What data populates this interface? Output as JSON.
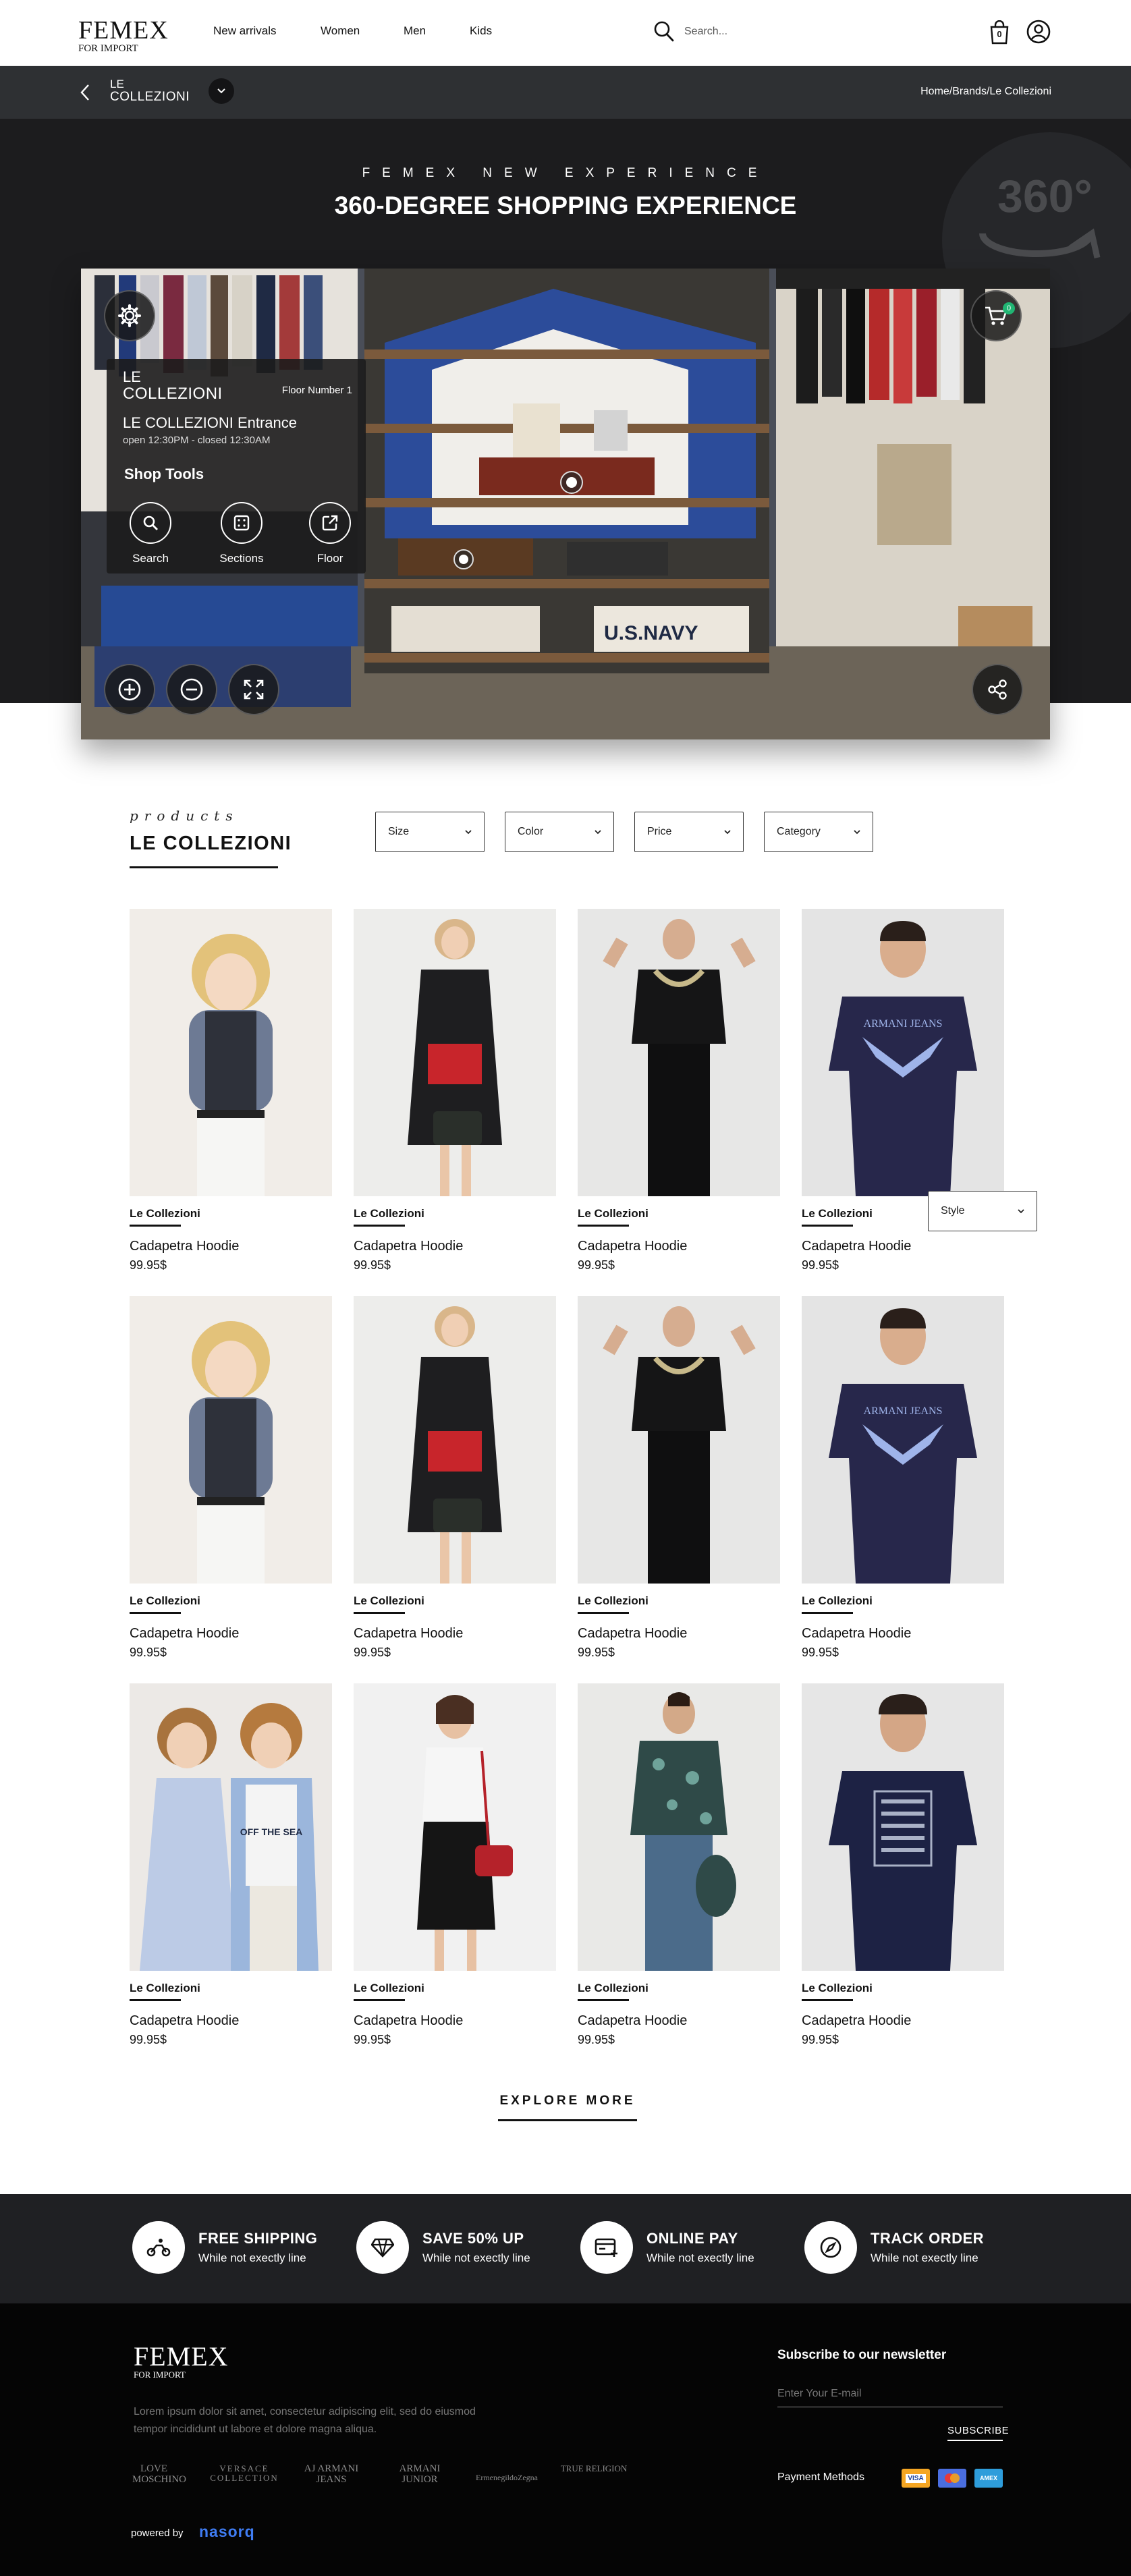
{
  "header": {
    "logo_main": "FEMEX",
    "logo_sub": "FOR IMPORT",
    "nav": [
      "New arrivals",
      "Women",
      "Men",
      "Kids"
    ],
    "search_placeholder": "Search...",
    "cart_count": "0"
  },
  "subbar": {
    "brand_top": "LE",
    "brand_bottom": "COLLEZIONI",
    "breadcrumb": "Home/Brands/Le Collezioni"
  },
  "hero": {
    "kicker": "FEMEX NEW EXPERIENCE",
    "title": "360-DEGREE SHOPPING EXPERIENCE",
    "badge": "360°",
    "panel": {
      "brand_top": "LE",
      "brand_bottom": "COLLEZIONI",
      "floor": "Floor Number 1",
      "entrance": "LE COLLEZIONI Entrance",
      "hours": "open 12:30PM - closed 12:30AM",
      "tools_title": "Shop Tools",
      "tools": [
        "Search",
        "Sections",
        "Floor"
      ]
    },
    "cart_badge": "0",
    "navy_text": "U.S.NAVY"
  },
  "products": {
    "kicker": "products",
    "title": "LE COLLEZIONI",
    "filters": [
      "Size",
      "Color",
      "Price",
      "Category"
    ],
    "style_filter": "Style",
    "items": [
      {
        "brand": "Le Collezioni",
        "name": "Cadapetra Hoodie",
        "price": "99.95$"
      },
      {
        "brand": "Le Collezioni",
        "name": "Cadapetra Hoodie",
        "price": "99.95$"
      },
      {
        "brand": "Le Collezioni",
        "name": "Cadapetra Hoodie",
        "price": "99.95$"
      },
      {
        "brand": "Le Collezioni",
        "name": "Cadapetra Hoodie",
        "price": "99.95$"
      },
      {
        "brand": "Le Collezioni",
        "name": "Cadapetra Hoodie",
        "price": "99.95$"
      },
      {
        "brand": "Le Collezioni",
        "name": "Cadapetra Hoodie",
        "price": "99.95$"
      },
      {
        "brand": "Le Collezioni",
        "name": "Cadapetra Hoodie",
        "price": "99.95$"
      },
      {
        "brand": "Le Collezioni",
        "name": "Cadapetra Hoodie",
        "price": "99.95$"
      },
      {
        "brand": "Le Collezioni",
        "name": "Cadapetra Hoodie",
        "price": "99.95$"
      },
      {
        "brand": "Le Collezioni",
        "name": "Cadapetra Hoodie",
        "price": "99.95$"
      },
      {
        "brand": "Le Collezioni",
        "name": "Cadapetra Hoodie",
        "price": "99.95$"
      },
      {
        "brand": "Le Collezioni",
        "name": "Cadapetra Hoodie",
        "price": "99.95$"
      }
    ],
    "shirt_print_1": "ARMANI JEANS",
    "shirt_print_2": "ARMANI JEANS",
    "shirt_print_3": "OFF THE SEA",
    "explore": "EXPLORE MORE"
  },
  "features": [
    {
      "title": "FREE SHIPPING",
      "sub": "While not exectly line"
    },
    {
      "title": "SAVE 50% UP",
      "sub": "While not exectly line"
    },
    {
      "title": "ONLINE PAY",
      "sub": "While not exectly line"
    },
    {
      "title": "TRACK ORDER",
      "sub": "While not exectly line"
    }
  ],
  "footer": {
    "logo_main": "FEMEX",
    "logo_sub": "FOR IMPORT",
    "desc_line1": "Lorem ipsum dolor sit amet, consectetur adipiscing elit, sed do eiusmod",
    "desc_line2": "tempor incididunt ut labore et dolore magna aliqua.",
    "brands": [
      "LOVE MOSCHINO",
      "VERSACE COLLECTION",
      "AJ ARMANI JEANS",
      "ARMANI JUNIOR",
      "ErmenegildoZegna",
      "TRUE RELIGION"
    ],
    "newsletter_title": "Subscribe to our newsletter",
    "email_placeholder": "Enter Your E-mail",
    "subscribe": "SUBSCRIBE",
    "payment_label": "Payment Methods",
    "payments": [
      "VISA",
      "MC",
      "AMEX"
    ],
    "powered_label": "powered by",
    "powered_brand": "nasorq"
  },
  "colors": {
    "dark": "#1c1c1e",
    "subbar": "#2e3033",
    "accent_green": "#21b573",
    "powered_blue": "#3f7cf2"
  }
}
